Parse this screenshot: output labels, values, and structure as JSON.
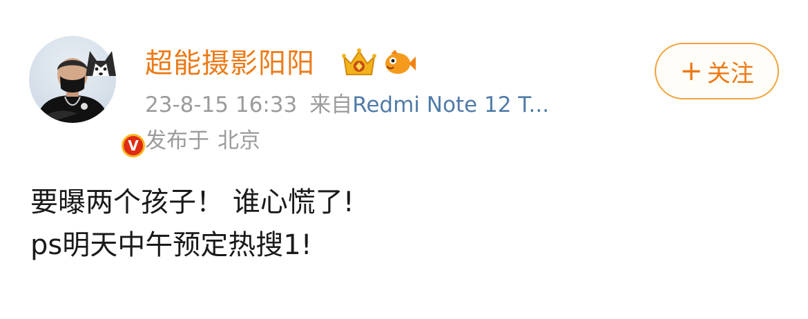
{
  "user": {
    "name": "超能摄影阳阳",
    "badges": [
      "crown-badge-icon",
      "fish-badge-icon"
    ],
    "verified_mark": "V"
  },
  "meta": {
    "time": "23-8-15 16:33",
    "from": "来自",
    "device": "Redmi Note 12 T...",
    "location_prefix": "发布于",
    "location": "北京"
  },
  "follow": {
    "plus": "+",
    "label": "关注"
  },
  "post": {
    "line1": "要曝两个孩子！ 谁心慌了!",
    "line2": "ps明天中午预定热搜1!"
  },
  "colors": {
    "accent": "#ec7a16",
    "link": "#507ba8",
    "meta": "#9b9b9b",
    "verified": "#e02a12"
  }
}
